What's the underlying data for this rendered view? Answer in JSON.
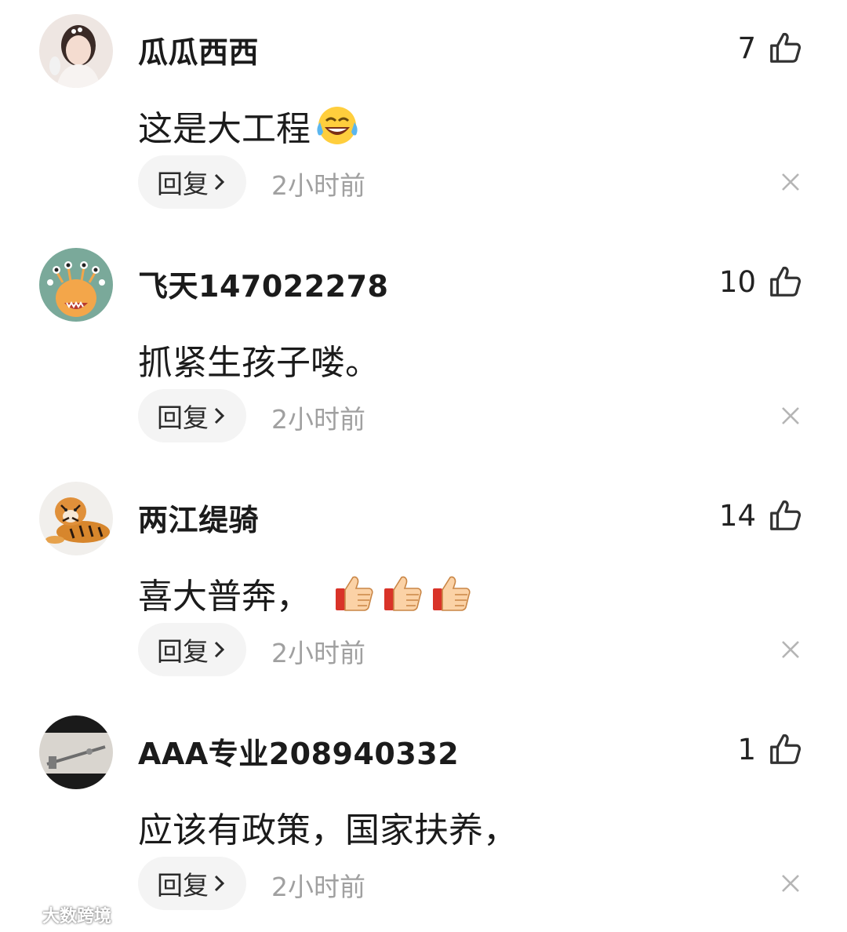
{
  "comments": [
    {
      "username": "瓜瓜西西",
      "likes": "7",
      "text": "这是大工程",
      "emoji": "laughing-crying-emoji",
      "reply_label": "回复",
      "time": "2小时前"
    },
    {
      "username": "飞天147022278",
      "likes": "10",
      "text": "抓紧生孩子喽。",
      "emoji": "",
      "reply_label": "回复",
      "time": "2小时前"
    },
    {
      "username": "两江缇骑",
      "likes": "14",
      "text": "喜大普奔，",
      "emoji": "thumbs-up-emoji x3",
      "reply_label": "回复",
      "time": "2小时前"
    },
    {
      "username": "AAA专业208940332",
      "likes": "1",
      "text": "应该有政策，国家扶养，",
      "emoji": "",
      "reply_label": "回复",
      "time": "2小时前"
    }
  ],
  "watermark": {
    "text": "大数跨境"
  },
  "colors": {
    "text": "#1b1b1b",
    "muted": "#a0a0a0",
    "pill": "#f4f4f4",
    "icon": "#333333"
  }
}
